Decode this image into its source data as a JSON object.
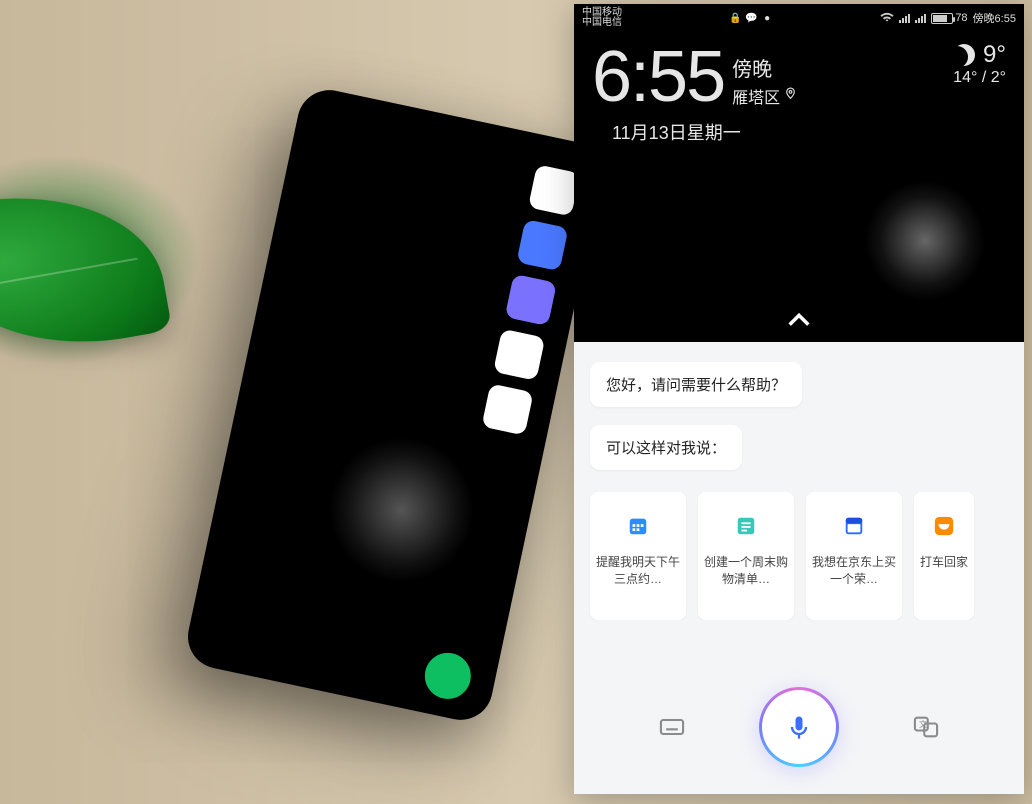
{
  "statusbar": {
    "carrier1": "中国移动",
    "carrier2": "中国电信",
    "battery_pct": 78,
    "battery_label": "78",
    "clock": "傍晚6:55"
  },
  "home": {
    "time": "6:55",
    "period": "傍晚",
    "location": "雁塔区",
    "date": "11月13日星期一",
    "weather": {
      "temp": "9°",
      "hi_lo": "14° / 2°"
    }
  },
  "assistant": {
    "greeting": "您好，请问需要什么帮助？",
    "hint": "可以这样对我说：",
    "suggestions": [
      {
        "label": "提醒我明天下午三点约…",
        "icon": "calendar",
        "color": "#2d8cff"
      },
      {
        "label": "创建一个周末购物清单…",
        "icon": "note",
        "color": "#37c8b9"
      },
      {
        "label": "我想在京东上买一个荣…",
        "icon": "browser",
        "color": "#2d6bff"
      },
      {
        "label": "打车回家",
        "icon": "didi",
        "color": "#ff8a00"
      }
    ]
  }
}
